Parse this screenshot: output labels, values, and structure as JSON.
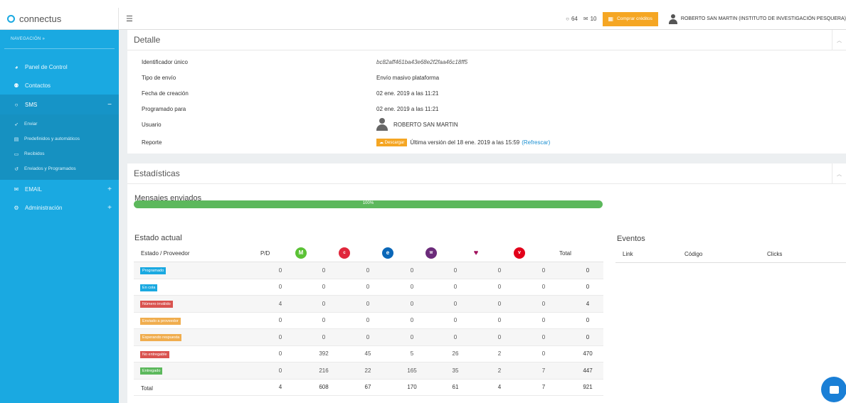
{
  "app": {
    "brand": "connectus"
  },
  "sidebar": {
    "nav_label": "NAVEGACIÓN »",
    "items": [
      {
        "label": "Panel de Control",
        "icon": "dashboard-icon"
      },
      {
        "label": "Contactos",
        "icon": "users-icon"
      },
      {
        "label": "SMS",
        "icon": "chat-icon",
        "toggle": "−"
      },
      {
        "label": "EMAIL",
        "icon": "envelope-icon",
        "toggle": "+"
      },
      {
        "label": "Administración",
        "icon": "gears-icon",
        "toggle": "+"
      }
    ],
    "sms_sub": [
      {
        "label": "Enviar",
        "icon": "send-icon"
      },
      {
        "label": "Predefinidos y automáticos",
        "icon": "list-icon"
      },
      {
        "label": "Recibidos",
        "icon": "inbox-icon"
      },
      {
        "label": "Enviados y Programados",
        "icon": "history-icon"
      }
    ]
  },
  "topbar": {
    "chat_count": "64",
    "mail_count": "10",
    "buy_label": "Comprar créditos",
    "user": "ROBERTO SAN MARTIN (INSTITUTO DE INVESTIGACIÓN PESQUERA)"
  },
  "detalle": {
    "title": "Detalle",
    "rows": [
      {
        "label": "Identificador único",
        "value": "bc82aff461ba43e68e2f2faa46c18ff5"
      },
      {
        "label": "Tipo de envío",
        "value": "Envío masivo plataforma"
      },
      {
        "label": "Fecha de creación",
        "value": "02 ene. 2019 a las 11:21"
      },
      {
        "label": "Programado para",
        "value": "02 ene. 2019 a las 11:21"
      },
      {
        "label": "Usuario",
        "value": "ROBERTO SAN MARTIN"
      },
      {
        "label": "Reporte",
        "value": "Última versión del 18 ene. 2019 a las 15:59"
      }
    ],
    "download_label": "Descargar",
    "refresh_label": "(Refrescar)"
  },
  "estadisticas": {
    "title": "Estadísticas",
    "mensajes_title": "Mensajes enviados",
    "progress": 100,
    "progress_label": "100%",
    "estado_title": "Estado actual",
    "table": {
      "headers": {
        "estado": "Estado / Proveedor",
        "pd": "P/D",
        "total": "Total"
      },
      "providers": [
        {
          "name": "movistar-logo",
          "color": "#5bc236",
          "glyph": "M"
        },
        {
          "name": "claro-logo",
          "color": "#e0263b",
          "glyph": "c"
        },
        {
          "name": "entel-logo",
          "color": "#0a67b8",
          "glyph": "e"
        },
        {
          "name": "wom-logo",
          "color": "#6b2b7a",
          "glyph": "w"
        },
        {
          "name": "vtr-logo",
          "color": "#c8102e",
          "glyph": "♥"
        },
        {
          "name": "virgin-logo",
          "color": "#e2001a",
          "glyph": "v"
        }
      ],
      "rows": [
        {
          "status": "Programado",
          "color": "#1aa9e1",
          "values": [
            "0",
            "0",
            "0",
            "0",
            "0",
            "0",
            "0",
            "0"
          ]
        },
        {
          "status": "En cola",
          "color": "#1aa9e1",
          "values": [
            "0",
            "0",
            "0",
            "0",
            "0",
            "0",
            "0",
            "0"
          ]
        },
        {
          "status": "Número inválido",
          "color": "#d9534f",
          "values": [
            "4",
            "0",
            "0",
            "0",
            "0",
            "0",
            "0",
            "4"
          ]
        },
        {
          "status": "Enviado a proveedor",
          "color": "#f0ad4e",
          "values": [
            "0",
            "0",
            "0",
            "0",
            "0",
            "0",
            "0",
            "0"
          ]
        },
        {
          "status": "Esperando respuesta",
          "color": "#f0ad4e",
          "values": [
            "0",
            "0",
            "0",
            "0",
            "0",
            "0",
            "0",
            "0"
          ]
        },
        {
          "status": "No entregable",
          "color": "#d9534f",
          "values": [
            "0",
            "392",
            "45",
            "5",
            "26",
            "2",
            "0",
            "470"
          ]
        },
        {
          "status": "Entregado",
          "color": "#5cb85c",
          "values": [
            "0",
            "216",
            "22",
            "165",
            "35",
            "2",
            "7",
            "447"
          ]
        }
      ],
      "total_row": {
        "label": "Total",
        "values": [
          "4",
          "608",
          "67",
          "170",
          "61",
          "4",
          "7",
          "921"
        ]
      }
    },
    "eventos": {
      "title": "Eventos",
      "headers": [
        "Link",
        "Código",
        "Clicks"
      ]
    }
  }
}
